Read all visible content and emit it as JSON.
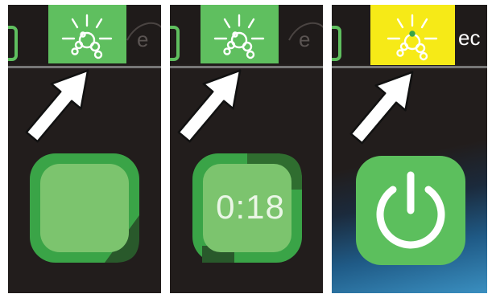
{
  "panels": [
    {
      "name": "step-1",
      "top_button_color": "#5fbf5f",
      "main_button": "empty"
    },
    {
      "name": "step-2",
      "top_button_color": "#5fbf5f",
      "main_button": "countdown",
      "timer": "0:18"
    },
    {
      "name": "step-3",
      "top_button_color": "#f6ea17",
      "main_button": "power",
      "brand": "ec"
    }
  ],
  "icons": {
    "top_button": "light-bubbles-icon",
    "pointer": "arrow-pointer-icon",
    "main_button_panel_3": "power-icon"
  },
  "colors": {
    "screen_bg": "#221d1c",
    "green": "#5fbf5f",
    "green_dark": "#3e8e3c",
    "yellow": "#f6ea17"
  }
}
